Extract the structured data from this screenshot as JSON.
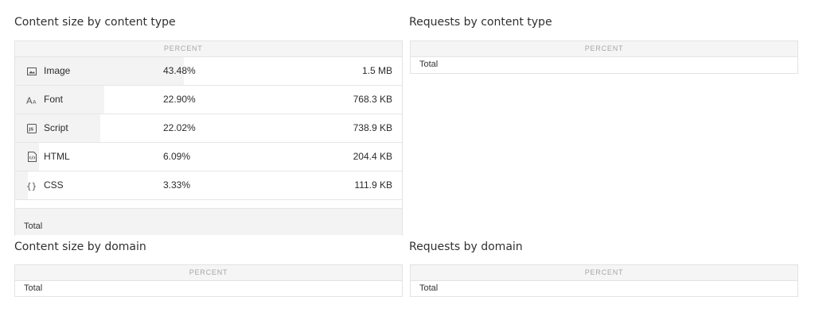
{
  "panels": {
    "content_size_by_type": {
      "title": "Content size by content type",
      "header": "PERCENT",
      "rows": [
        {
          "name": "Image",
          "icon": "image-icon",
          "percent": "43.48%",
          "size": "1.5 MB",
          "share": 0.4348
        },
        {
          "name": "Font",
          "icon": "font-icon",
          "percent": "22.90%",
          "size": "768.3 KB",
          "share": 0.229
        },
        {
          "name": "Script",
          "icon": "script-icon",
          "percent": "22.02%",
          "size": "738.9 KB",
          "share": 0.2202
        },
        {
          "name": "HTML",
          "icon": "html-icon",
          "percent": "6.09%",
          "size": "204.4 KB",
          "share": 0.0609
        },
        {
          "name": "CSS",
          "icon": "css-icon",
          "percent": "3.33%",
          "size": "111.9 KB",
          "share": 0.0333
        }
      ],
      "total_label": "Total"
    },
    "requests_by_type": {
      "title": "Requests by content type",
      "header": "PERCENT",
      "total_label": "Total"
    },
    "content_size_by_domain": {
      "title": "Content size by domain",
      "header": "PERCENT",
      "total_label": "Total"
    },
    "requests_by_domain": {
      "title": "Requests by domain",
      "header": "PERCENT",
      "total_label": "Total"
    }
  }
}
